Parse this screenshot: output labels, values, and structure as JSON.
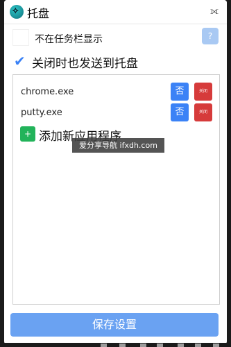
{
  "window": {
    "title": "托盘",
    "app_icon": "tray-app-icon",
    "close_icon": "close-icon"
  },
  "options": {
    "hide_taskbar_label": "不在任务栏显示",
    "send_to_tray_label": "关闭时也发送到托盘",
    "send_to_tray_checked": true,
    "help_label": "?"
  },
  "app_list": [
    {
      "name": "chrome.exe",
      "no_label": "否",
      "close_label": "关闭"
    },
    {
      "name": "putty.exe",
      "no_label": "否",
      "close_label": "关闭"
    }
  ],
  "add_app": {
    "icon_label": "+",
    "label": "添加新应用程序"
  },
  "watermark": "爱分享导航 ifxdh.com",
  "save_label": "保存设置",
  "colors": {
    "accent": "#3b82f6",
    "danger": "#d63b3b",
    "success": "#22b35a",
    "save": "#6aa2f2"
  }
}
